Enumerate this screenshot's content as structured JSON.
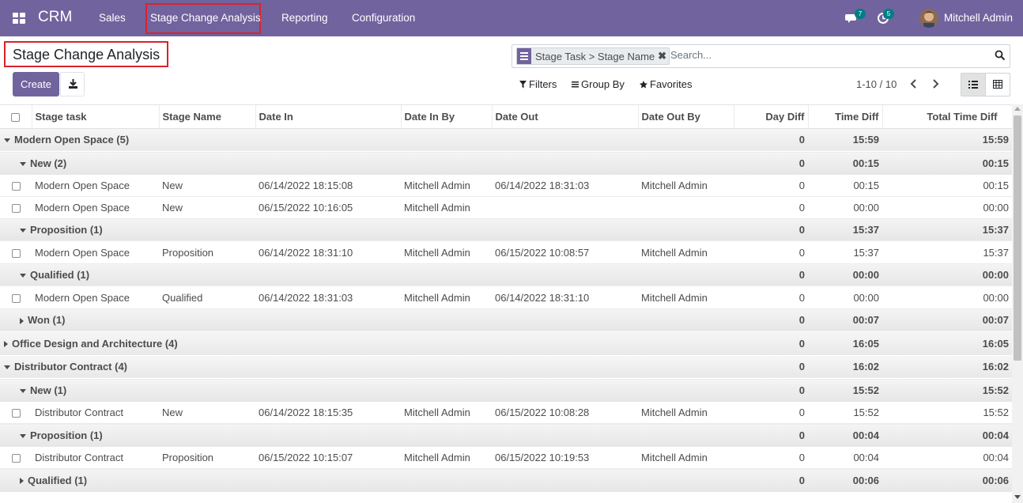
{
  "navbar": {
    "brand": "CRM",
    "menu": [
      "Sales",
      "Stage Change Analysis",
      "Reporting",
      "Configuration"
    ],
    "chat_count": "7",
    "activity_count": "5",
    "user_name": "Mitchell Admin",
    "color": "#71639e"
  },
  "control": {
    "title": "Stage Change Analysis",
    "create_label": "Create",
    "facet_label": "Stage Task > Stage Name",
    "search_placeholder": "Search...",
    "filters_label": "Filters",
    "groupby_label": "Group By",
    "favorites_label": "Favorites",
    "pager": "1-10 / 10"
  },
  "table": {
    "columns": [
      "Stage task",
      "Stage Name",
      "Date In",
      "Date In By",
      "Date Out",
      "Date Out By",
      "Day Diff",
      "Time Diff",
      "Total Time Diff"
    ],
    "rows": [
      {
        "type": "group",
        "level": 0,
        "open": true,
        "label": "Modern Open Space (5)",
        "day": "0",
        "time": "15:59",
        "total": "15:59"
      },
      {
        "type": "group",
        "level": 1,
        "open": true,
        "label": "New (2)",
        "day": "0",
        "time": "00:15",
        "total": "00:15"
      },
      {
        "type": "record",
        "cells": [
          "Modern Open Space",
          "New",
          "06/14/2022 18:15:08",
          "Mitchell Admin",
          "06/14/2022 18:31:03",
          "Mitchell Admin",
          "0",
          "00:15",
          "00:15"
        ]
      },
      {
        "type": "record",
        "cells": [
          "Modern Open Space",
          "New",
          "06/15/2022 10:16:05",
          "Mitchell Admin",
          "",
          "",
          "0",
          "00:00",
          "00:00"
        ]
      },
      {
        "type": "group",
        "level": 1,
        "open": true,
        "label": "Proposition (1)",
        "day": "0",
        "time": "15:37",
        "total": "15:37"
      },
      {
        "type": "record",
        "cells": [
          "Modern Open Space",
          "Proposition",
          "06/14/2022 18:31:10",
          "Mitchell Admin",
          "06/15/2022 10:08:57",
          "Mitchell Admin",
          "0",
          "15:37",
          "15:37"
        ]
      },
      {
        "type": "group",
        "level": 1,
        "open": true,
        "label": "Qualified (1)",
        "day": "0",
        "time": "00:00",
        "total": "00:00"
      },
      {
        "type": "record",
        "cells": [
          "Modern Open Space",
          "Qualified",
          "06/14/2022 18:31:03",
          "Mitchell Admin",
          "06/14/2022 18:31:10",
          "Mitchell Admin",
          "0",
          "00:00",
          "00:00"
        ]
      },
      {
        "type": "group",
        "level": 1,
        "open": false,
        "label": "Won (1)",
        "day": "0",
        "time": "00:07",
        "total": "00:07"
      },
      {
        "type": "group",
        "level": 0,
        "open": false,
        "label": "Office Design and Architecture (4)",
        "day": "0",
        "time": "16:05",
        "total": "16:05"
      },
      {
        "type": "group",
        "level": 0,
        "open": true,
        "label": "Distributor Contract (4)",
        "day": "0",
        "time": "16:02",
        "total": "16:02"
      },
      {
        "type": "group",
        "level": 1,
        "open": true,
        "label": "New (1)",
        "day": "0",
        "time": "15:52",
        "total": "15:52"
      },
      {
        "type": "record",
        "cells": [
          "Distributor Contract",
          "New",
          "06/14/2022 18:15:35",
          "Mitchell Admin",
          "06/15/2022 10:08:28",
          "Mitchell Admin",
          "0",
          "15:52",
          "15:52"
        ]
      },
      {
        "type": "group",
        "level": 1,
        "open": true,
        "label": "Proposition (1)",
        "day": "0",
        "time": "00:04",
        "total": "00:04"
      },
      {
        "type": "record",
        "cells": [
          "Distributor Contract",
          "Proposition",
          "06/15/2022 10:15:07",
          "Mitchell Admin",
          "06/15/2022 10:19:53",
          "Mitchell Admin",
          "0",
          "00:04",
          "00:04"
        ]
      },
      {
        "type": "group",
        "level": 1,
        "open": false,
        "label": "Qualified (1)",
        "day": "0",
        "time": "00:06",
        "total": "00:06"
      }
    ]
  }
}
